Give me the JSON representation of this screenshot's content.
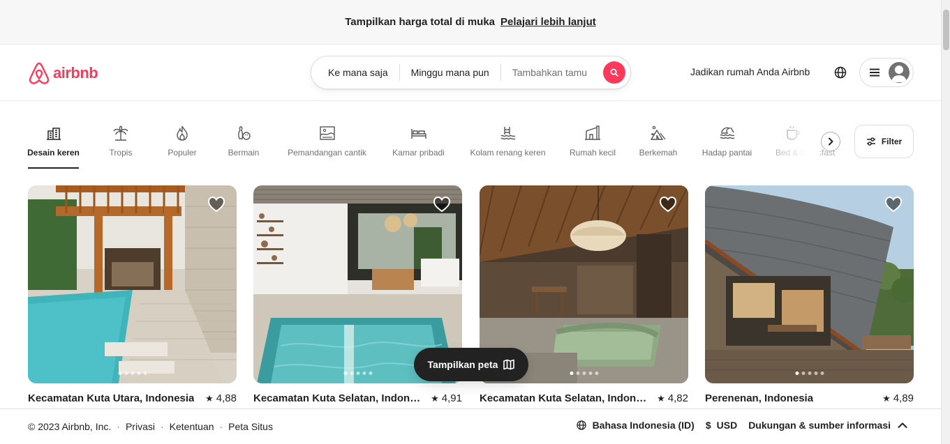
{
  "banner": {
    "message": "Tampilkan harga total di muka",
    "link": "Pelajari lebih lanjut"
  },
  "header": {
    "logo_text": "airbnb",
    "brand_color": "#ff385c",
    "search": {
      "where": "Ke mana saja",
      "when": "Minggu mana pun",
      "guests": "Tambahkan tamu"
    },
    "host_link": "Jadikan rumah Anda Airbnb"
  },
  "categories": [
    {
      "label": "Desain keren",
      "icon": "design-building-icon",
      "active": true
    },
    {
      "label": "Tropis",
      "icon": "palm-tree-icon"
    },
    {
      "label": "Populer",
      "icon": "flame-icon"
    },
    {
      "label": "Bermain",
      "icon": "bowling-icon"
    },
    {
      "label": "Pemandangan cantik",
      "icon": "landscape-frame-icon"
    },
    {
      "label": "Kamar pribadi",
      "icon": "bed-icon"
    },
    {
      "label": "Kolam renang keren",
      "icon": "pool-icon"
    },
    {
      "label": "Rumah kecil",
      "icon": "tiny-house-icon"
    },
    {
      "label": "Berkemah",
      "icon": "tent-icon"
    },
    {
      "label": "Hadap pantai",
      "icon": "beach-wave-icon"
    },
    {
      "label": "Bed & breakfast",
      "icon": "coffee-cup-icon"
    }
  ],
  "filter_label": "Filter",
  "listings": [
    {
      "location": "Kecamatan Kuta Utara, Indonesia",
      "rating": "4,88",
      "photo_dots": 5,
      "active_dot": 0
    },
    {
      "location": "Kecamatan Kuta Selatan, Indonesia",
      "rating": "4,91",
      "photo_dots": 5,
      "active_dot": 0
    },
    {
      "location": "Kecamatan Kuta Selatan, Indonesia",
      "rating": "4,82",
      "photo_dots": 5,
      "active_dot": 0
    },
    {
      "location": "Perenenan, Indonesia",
      "rating": "4,89",
      "photo_dots": 5,
      "active_dot": 0
    }
  ],
  "map_button": "Tampilkan peta",
  "footer": {
    "copyright": "© 2023 Airbnb, Inc.",
    "links": [
      "Privasi",
      "Ketentuan",
      "Peta Situs"
    ],
    "language": "Bahasa Indonesia (ID)",
    "currency_symbol": "$",
    "currency": "USD",
    "support": "Dukungan & sumber informasi"
  }
}
